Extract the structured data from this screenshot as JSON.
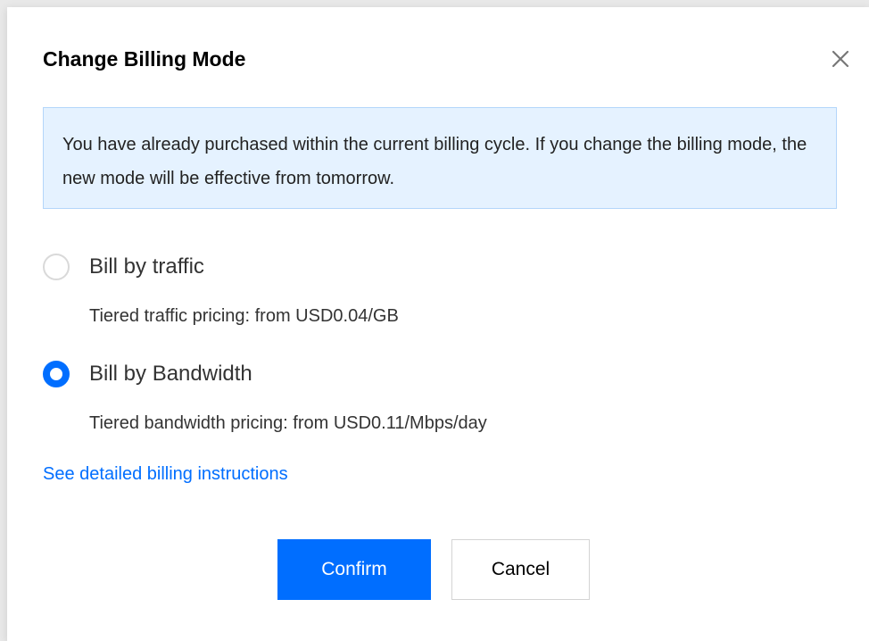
{
  "dialog": {
    "title": "Change Billing Mode",
    "close_icon": "close-icon"
  },
  "notice": {
    "text": "You have already purchased within the current billing cycle. If you change the billing mode, the new mode will be effective from tomorrow."
  },
  "options": [
    {
      "label": "Bill by traffic",
      "description": "Tiered traffic pricing: from USD0.04/GB",
      "selected": false
    },
    {
      "label": "Bill by Bandwidth",
      "description": "Tiered bandwidth pricing: from USD0.11/Mbps/day",
      "selected": true
    }
  ],
  "link": {
    "text": "See detailed billing instructions"
  },
  "buttons": {
    "confirm": "Confirm",
    "cancel": "Cancel"
  },
  "colors": {
    "accent": "#006eff",
    "notice_background": "#e5f2ff",
    "notice_border": "#b4d6fa"
  }
}
